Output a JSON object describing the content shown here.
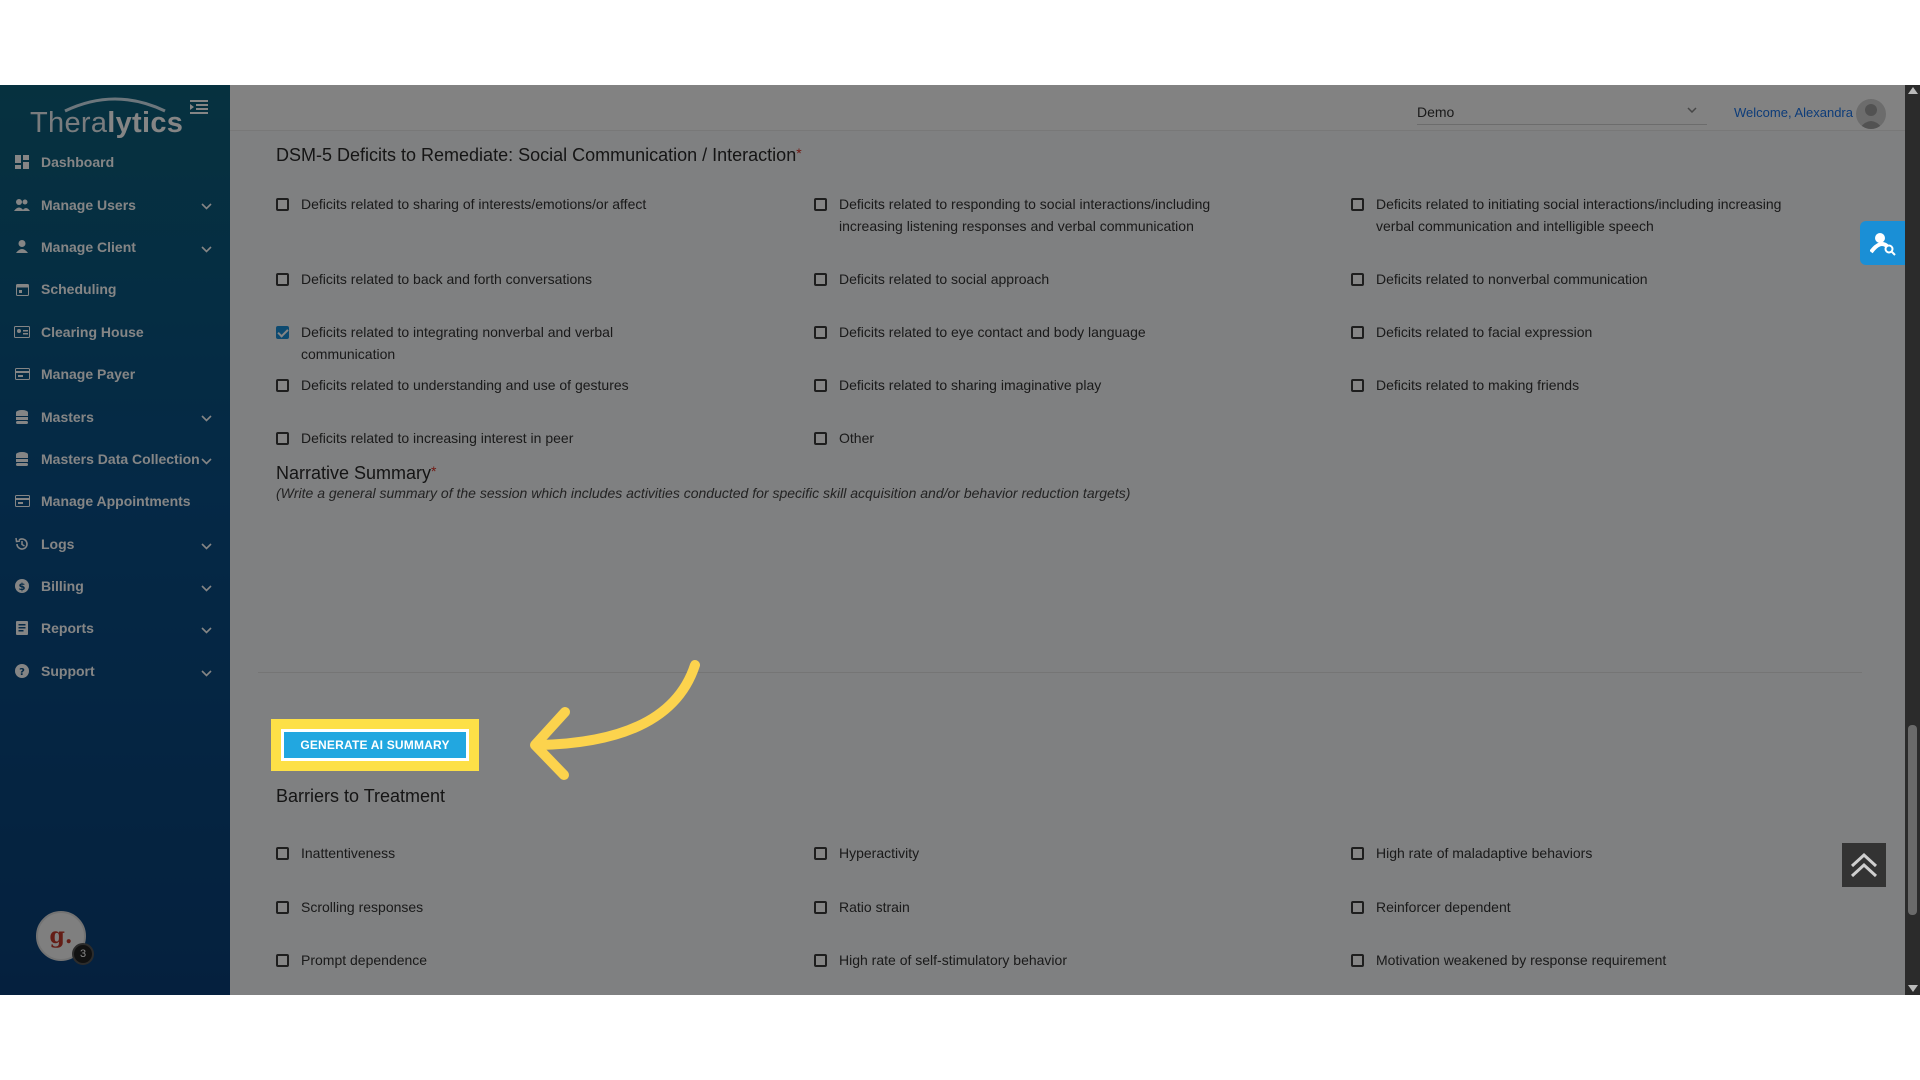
{
  "brand": {
    "logo_light": "Thera",
    "logo_bold": "lytics"
  },
  "sidebar": {
    "items": [
      {
        "label": "Dashboard",
        "icon": "dashboard-icon",
        "expandable": false
      },
      {
        "label": "Manage Users",
        "icon": "users-icon",
        "expandable": true
      },
      {
        "label": "Manage Client",
        "icon": "person-icon",
        "expandable": true
      },
      {
        "label": "Scheduling",
        "icon": "calendar-icon",
        "expandable": false
      },
      {
        "label": "Clearing House",
        "icon": "id-card-icon",
        "expandable": false
      },
      {
        "label": "Manage Payer",
        "icon": "card-icon",
        "expandable": false
      },
      {
        "label": "Masters",
        "icon": "database-icon",
        "expandable": true
      },
      {
        "label": "Masters Data Collection",
        "icon": "database-icon",
        "expandable": true
      },
      {
        "label": "Manage Appointments",
        "icon": "card-icon",
        "expandable": false
      },
      {
        "label": "Logs",
        "icon": "history-icon",
        "expandable": true
      },
      {
        "label": "Billing",
        "icon": "dollar-icon",
        "expandable": true
      },
      {
        "label": "Reports",
        "icon": "report-icon",
        "expandable": true
      },
      {
        "label": "Support",
        "icon": "help-icon",
        "expandable": true
      }
    ],
    "badge": {
      "letter": "g.",
      "count": "3"
    }
  },
  "topbar": {
    "org_select": "Demo",
    "welcome": "Welcome, Alexandra"
  },
  "dsm": {
    "title": "DSM-5 Deficits to Remediate: Social Communication / Interaction",
    "required": "*",
    "options": [
      {
        "label": "Deficits related to sharing of interests/emotions/or affect",
        "checked": false
      },
      {
        "label": "Deficits related to responding to social interactions/including increasing listening responses and verbal communication",
        "checked": false
      },
      {
        "label": "Deficits related to initiating social interactions/including increasing verbal communication and intelligible speech",
        "checked": false
      },
      {
        "label": "Deficits related to back and forth conversations",
        "checked": false
      },
      {
        "label": "Deficits related to social approach",
        "checked": false
      },
      {
        "label": "Deficits related to nonverbal communication",
        "checked": false
      },
      {
        "label": "Deficits related to integrating nonverbal and verbal communication",
        "checked": true
      },
      {
        "label": "Deficits related to eye contact and body language",
        "checked": false
      },
      {
        "label": "Deficits related to facial expression",
        "checked": false
      },
      {
        "label": "Deficits related to understanding and use of gestures",
        "checked": false
      },
      {
        "label": "Deficits related to sharing imaginative play",
        "checked": false
      },
      {
        "label": "Deficits related to making friends",
        "checked": false
      },
      {
        "label": "Deficits related to increasing interest in peer",
        "checked": false
      },
      {
        "label": "Other",
        "checked": false
      }
    ]
  },
  "narrative": {
    "title": "Narrative Summary",
    "required": "*",
    "subtitle": "(Write a general summary of the session which includes activities conducted for specific skill acquisition and/or behavior reduction targets)",
    "value": ""
  },
  "generate_button": {
    "label": "GENERATE AI SUMMARY"
  },
  "barriers": {
    "title": "Barriers to Treatment",
    "options": [
      {
        "label": "Inattentiveness",
        "checked": false
      },
      {
        "label": "Hyperactivity",
        "checked": false
      },
      {
        "label": "High rate of maladaptive behaviors",
        "checked": false
      },
      {
        "label": "Scrolling responses",
        "checked": false
      },
      {
        "label": "Ratio strain",
        "checked": false
      },
      {
        "label": "Reinforcer dependent",
        "checked": false
      },
      {
        "label": "Prompt dependence",
        "checked": false
      },
      {
        "label": "High rate of self-stimulatory behavior",
        "checked": false
      },
      {
        "label": "Motivation weakened by response requirement",
        "checked": false
      }
    ]
  },
  "colors": {
    "accent": "#22a7e0",
    "highlight": "#fde047",
    "sidebar": "#0a4f86"
  }
}
